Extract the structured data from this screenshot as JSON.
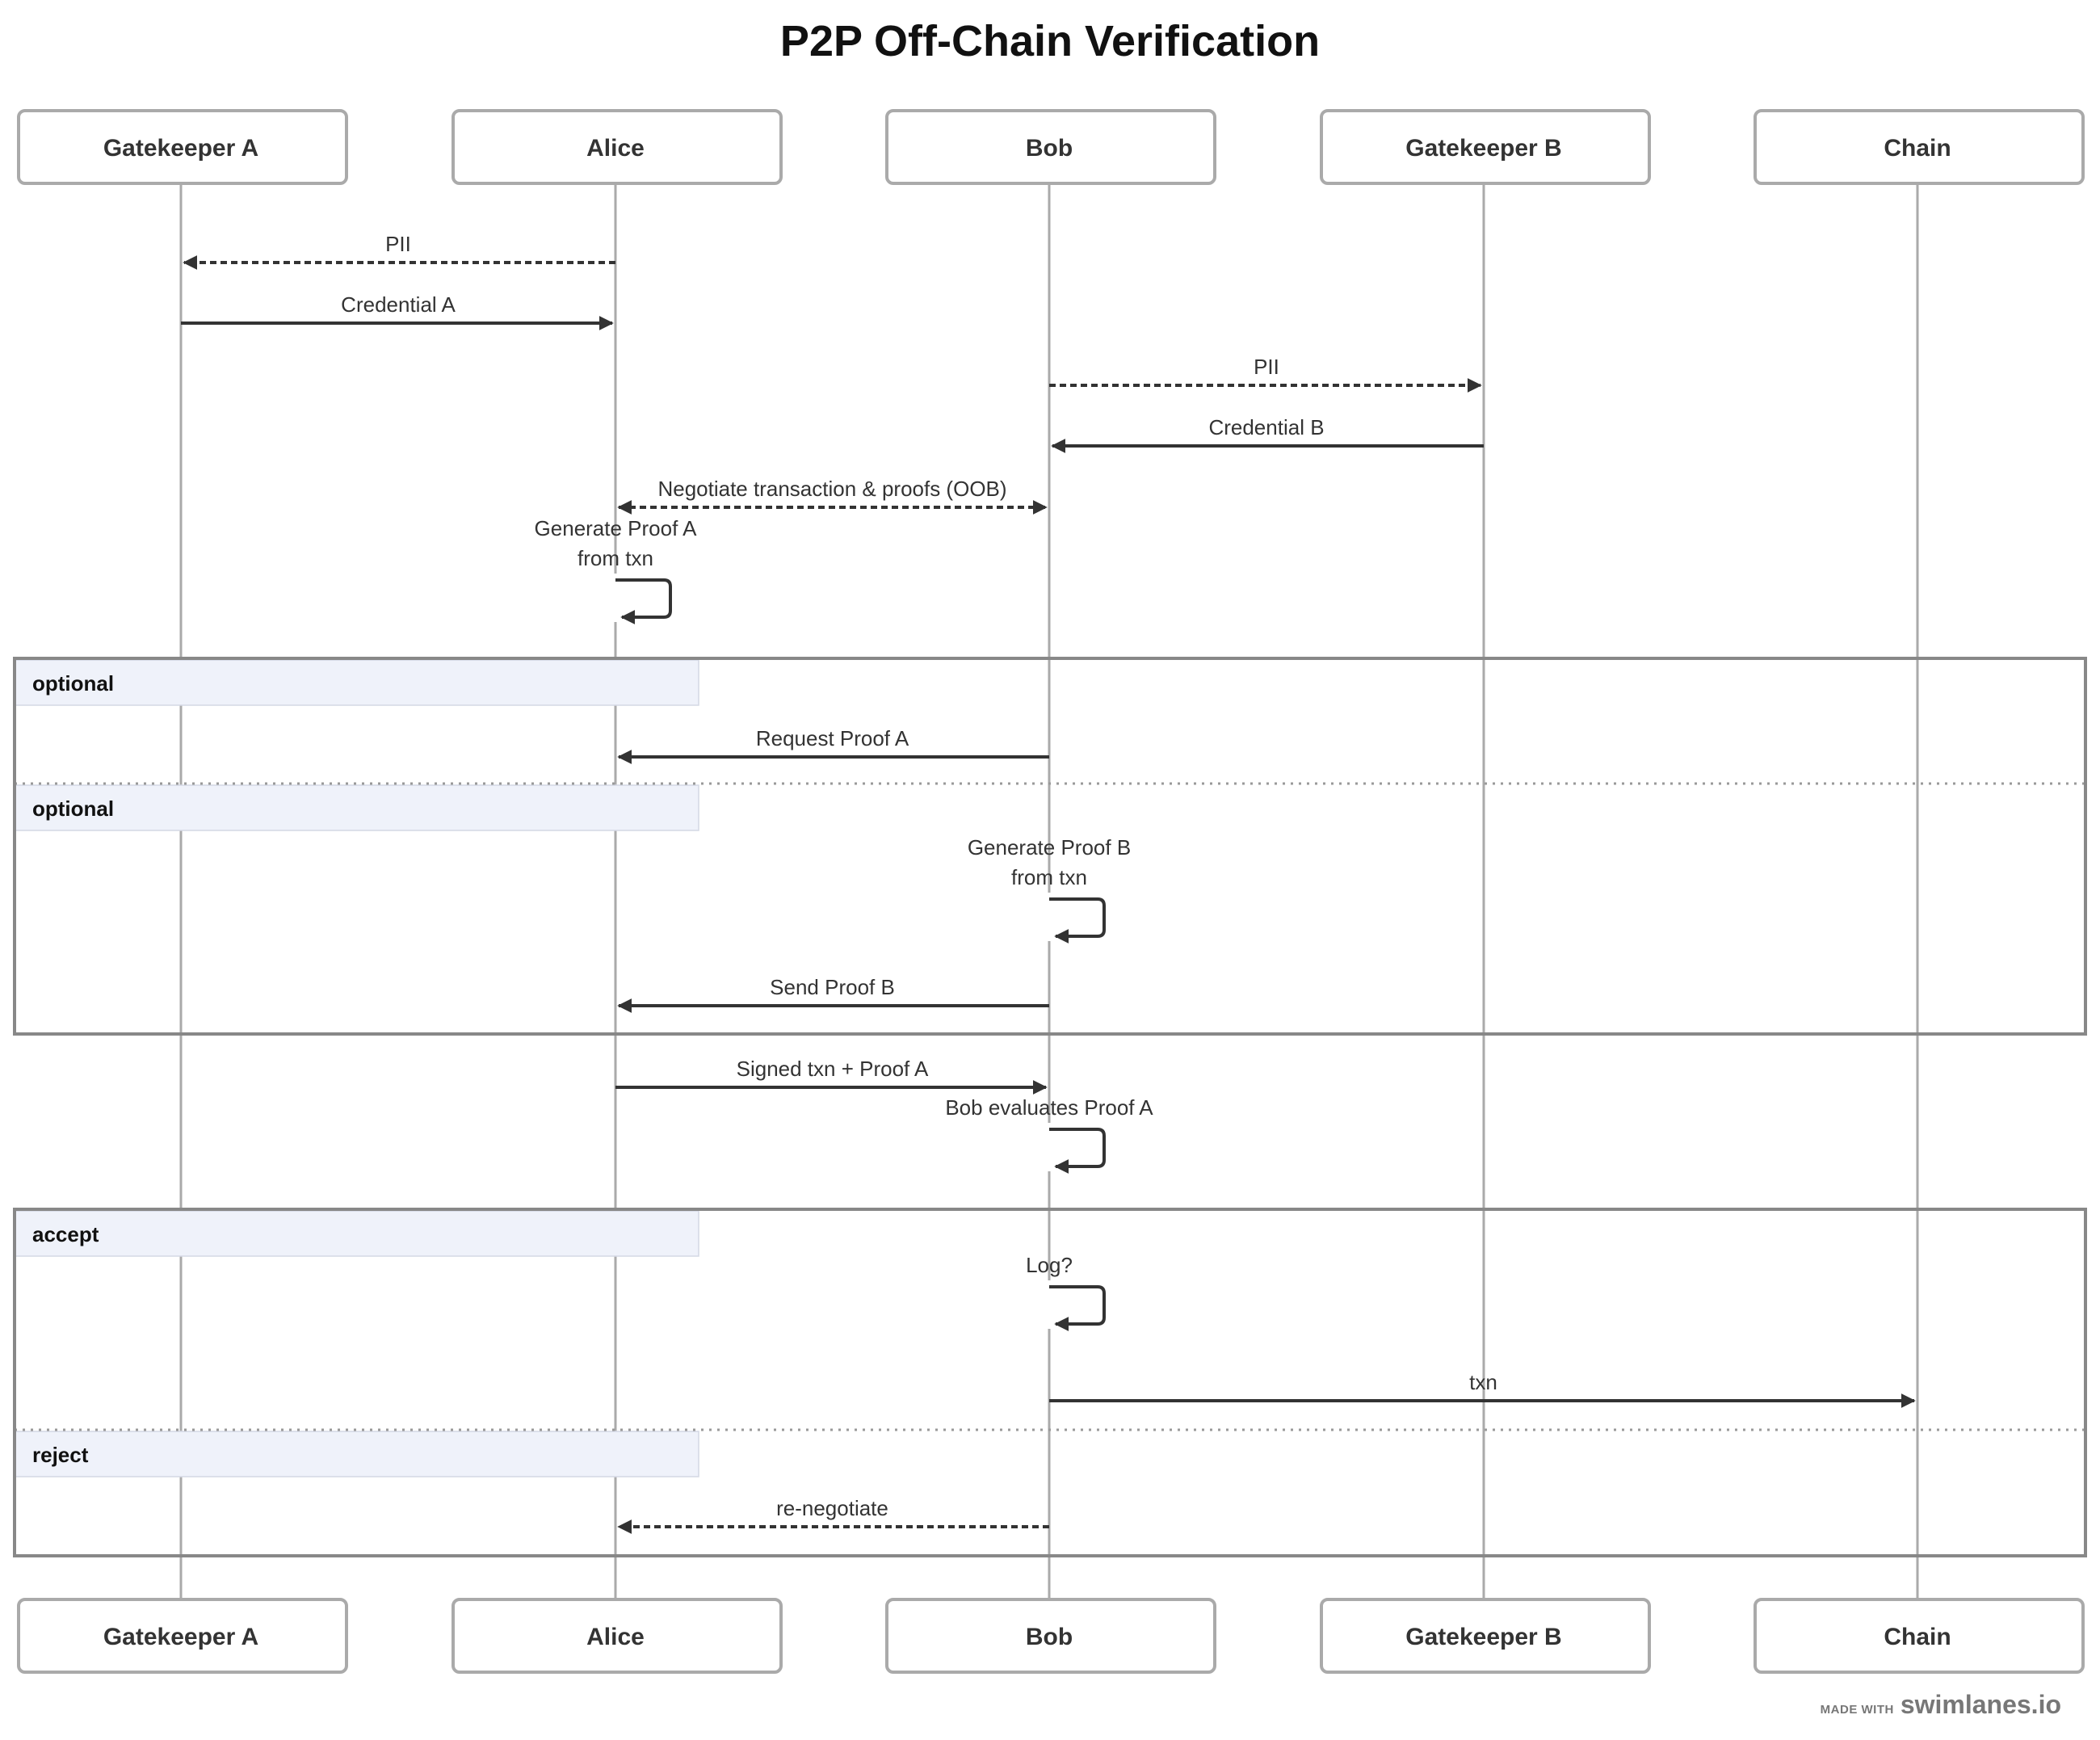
{
  "title": "P2P Off-Chain Verification",
  "actors": [
    "Gatekeeper A",
    "Alice",
    "Bob",
    "Gatekeeper B",
    "Chain"
  ],
  "messages": [
    {
      "from": 1,
      "to": 0,
      "label": "PII",
      "style": "dashed"
    },
    {
      "from": 0,
      "to": 1,
      "label": "Credential A",
      "style": "solid"
    },
    {
      "from": 2,
      "to": 3,
      "label": "PII",
      "style": "dashed"
    },
    {
      "from": 3,
      "to": 2,
      "label": "Credential B",
      "style": "solid"
    },
    {
      "from": 1,
      "to": 2,
      "label": "Negotiate transaction & proofs (OOB)",
      "style": "dashed",
      "bidirectional": true
    },
    {
      "from": 1,
      "to": 1,
      "label": "Generate Proof A\nfrom txn",
      "style": "self"
    },
    {
      "from": 2,
      "to": 1,
      "label": "Request Proof A",
      "style": "solid",
      "frame": "optional-1"
    },
    {
      "from": 2,
      "to": 2,
      "label": "Generate Proof B\nfrom txn",
      "style": "self",
      "frame": "optional-2"
    },
    {
      "from": 2,
      "to": 1,
      "label": "Send Proof B",
      "style": "solid",
      "frame": "optional-2"
    },
    {
      "from": 1,
      "to": 2,
      "label": "Signed txn + Proof A",
      "style": "solid"
    },
    {
      "from": 2,
      "to": 2,
      "label": "Bob evaluates Proof A",
      "style": "self"
    },
    {
      "from": 2,
      "to": 2,
      "label": "Log?",
      "style": "self",
      "frame": "accept"
    },
    {
      "from": 2,
      "to": 4,
      "label": "txn",
      "style": "solid",
      "frame": "accept"
    },
    {
      "from": 2,
      "to": 1,
      "label": "re-negotiate",
      "style": "dashed",
      "frame": "reject"
    }
  ],
  "frames": [
    {
      "sections": [
        "optional",
        "optional"
      ]
    },
    {
      "sections": [
        "accept",
        "reject"
      ]
    }
  ],
  "footer": {
    "made_with": "MADE WITH",
    "brand": "swimlanes.io"
  }
}
